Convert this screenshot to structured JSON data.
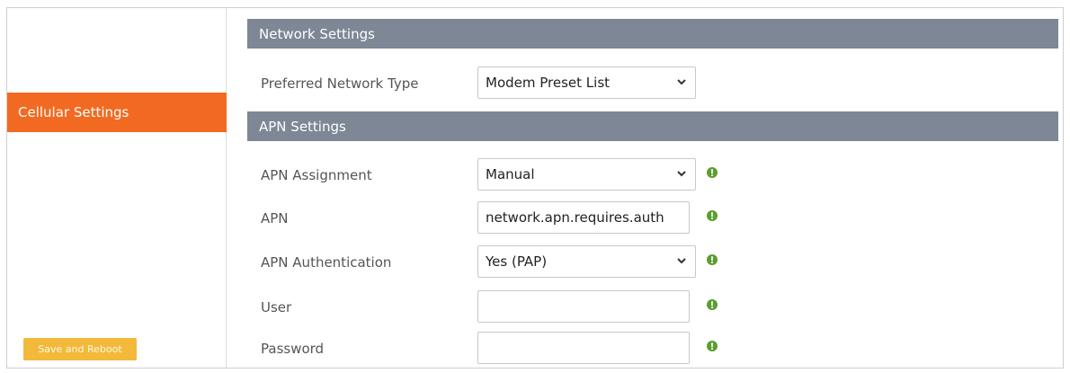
{
  "sidebar": {
    "active_item": "Cellular Settings",
    "save_button": "Save and Reboot"
  },
  "network_settings": {
    "header": "Network Settings",
    "preferred_network_type": {
      "label": "Preferred Network Type",
      "value": "Modem Preset List"
    }
  },
  "apn_settings": {
    "header": "APN Settings",
    "apn_assignment": {
      "label": "APN Assignment",
      "value": "Manual"
    },
    "apn": {
      "label": "APN",
      "value": "network.apn.requires.auth"
    },
    "apn_authentication": {
      "label": "APN Authentication",
      "value": "Yes (PAP)"
    },
    "user": {
      "label": "User",
      "value": ""
    },
    "password": {
      "label": "Password",
      "value": ""
    }
  },
  "colors": {
    "accent_orange": "#f26a21",
    "save_button": "#f2b93b",
    "section_header": "#7d8795",
    "info_icon": "#5a9e2f"
  },
  "icons": {
    "dropdown": "chevron-down-icon",
    "info": "info-icon"
  }
}
